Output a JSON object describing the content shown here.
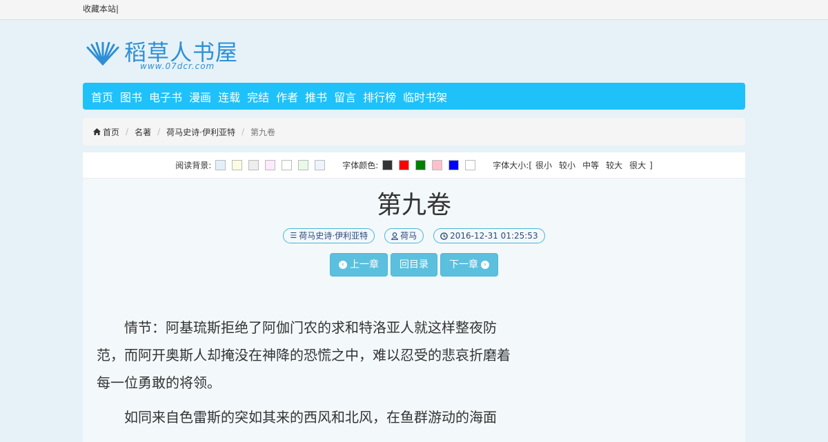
{
  "topbar": {
    "bookmark_label": "收藏本站|"
  },
  "logo": {
    "title": "稻草人书屋",
    "url": "www.07dcr.com"
  },
  "nav": {
    "items": [
      "首页",
      "图书",
      "电子书",
      "漫画",
      "连载",
      "完结",
      "作者",
      "推书",
      "留言",
      "排行榜",
      "临时书架"
    ]
  },
  "breadcrumb": {
    "home_icon": "home-icon",
    "home": "首页",
    "level1": "名著",
    "level2": "荷马史诗·伊利亚特",
    "current": "第九卷"
  },
  "toolbar": {
    "bg_label": "阅读背景:",
    "bg_colors": [
      "#e3f0fb",
      "#fcfce2",
      "#eeeeee",
      "#fcebfc",
      "#ffffff",
      "#e8fae8",
      "#eef4fb"
    ],
    "font_color_label": "字体颜色:",
    "font_colors": [
      "#333333",
      "#ff0000",
      "#008000",
      "#ffc0cb",
      "#0000ff",
      "#ffffff"
    ],
    "font_size_label": "字体大小:[",
    "font_sizes": [
      "很小",
      "较小",
      "中等",
      "较大",
      "很大"
    ],
    "font_size_close": "]"
  },
  "chapter": {
    "title": "第九卷",
    "book": "荷马史诗·伊利亚特",
    "author": "荷马",
    "date": "2016-12-31 01:25:53"
  },
  "buttons": {
    "prev": "上一章",
    "toc": "回目录",
    "next": "下一章"
  },
  "content": {
    "paragraphs": [
      "情节：阿基琉斯拒绝了阿伽门农的求和特洛亚人就这样整夜防范，而阿开奥斯人却掩没在神降的恐慌之中，难以忍受的悲哀折磨着每一位勇敢的将领。",
      "如同来自色雷斯的突如其来的西风和北风，在鱼群游动的海面"
    ]
  }
}
